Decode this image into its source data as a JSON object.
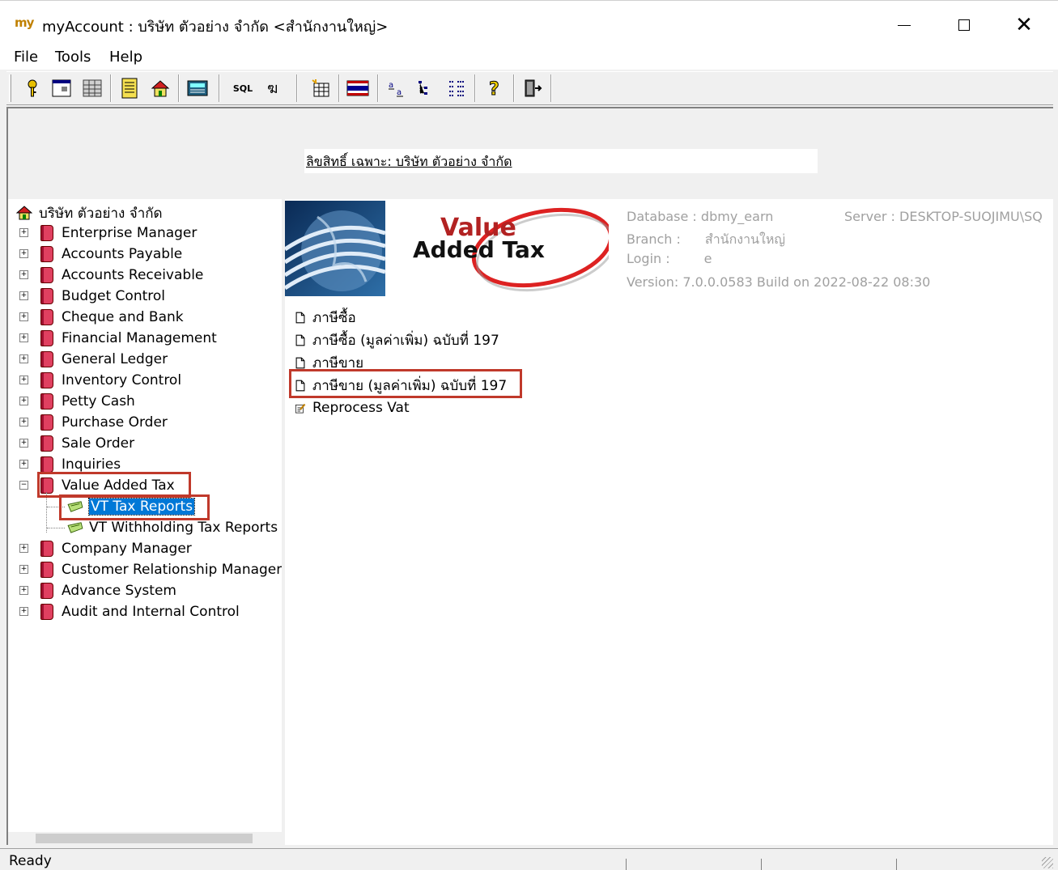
{
  "window": {
    "app_icon_label": "my",
    "title": "myAccount : บริษัท ตัวอย่าง จำกัด <สำนักงานใหญ่>"
  },
  "menu": {
    "items": [
      {
        "label": "File"
      },
      {
        "label": "Tools"
      },
      {
        "label": "Help"
      }
    ]
  },
  "toolbar": {
    "buttons": [
      {
        "icon": "key-icon"
      },
      {
        "icon": "window-icon"
      },
      {
        "icon": "grid-icon"
      },
      {
        "icon": "ledger-icon"
      },
      {
        "icon": "home-icon"
      },
      {
        "icon": "calculator-icon"
      },
      {
        "icon": "sql-icon",
        "label": "SQL"
      },
      {
        "icon": "translate-icon"
      },
      {
        "icon": "table-new-icon"
      },
      {
        "icon": "flag-icon"
      },
      {
        "icon": "text-format-icon"
      },
      {
        "icon": "tree-view-icon"
      },
      {
        "icon": "list-view-icon"
      },
      {
        "icon": "help-icon"
      },
      {
        "icon": "exit-icon"
      }
    ]
  },
  "header": {
    "license_text": "ลิขสิทธิ์ เฉพาะ: บริษัท ตัวอย่าง จำกัด"
  },
  "tree": {
    "root_label": "บริษัท ตัวอย่าง จำกัด",
    "items": [
      {
        "label": "Enterprise Manager"
      },
      {
        "label": "Accounts Payable"
      },
      {
        "label": "Accounts Receivable"
      },
      {
        "label": "Budget Control"
      },
      {
        "label": "Cheque and Bank"
      },
      {
        "label": "Financial Management"
      },
      {
        "label": "General Ledger"
      },
      {
        "label": "Inventory Control"
      },
      {
        "label": "Petty Cash"
      },
      {
        "label": "Purchase Order"
      },
      {
        "label": "Sale Order"
      },
      {
        "label": "Inquiries"
      },
      {
        "label": "Value Added Tax"
      },
      {
        "label": "VT Tax Reports"
      },
      {
        "label": "VT Withholding Tax Reports"
      },
      {
        "label": "Company Manager"
      },
      {
        "label": "Customer Relationship Management"
      },
      {
        "label": "Advance System"
      },
      {
        "label": "Audit and Internal Control"
      }
    ]
  },
  "banner": {
    "word1": "Value",
    "word2": "Added Tax"
  },
  "info": {
    "database_label": "Database :",
    "database_value": "dbmy_earn",
    "server_label": "Server :",
    "server_value": "DESKTOP-SUOJIMU\\SQ",
    "branch_label": "Branch :",
    "branch_value": "สำนักงานใหญ่",
    "login_label": "Login :",
    "login_value": "e",
    "version_text": "Version: 7.0.0.0583  Build on 2022-08-22 08:30"
  },
  "content": {
    "items": [
      {
        "label": "ภาษีซื้อ",
        "icon": "document-icon"
      },
      {
        "label": "ภาษีซื้อ (มูลค่าเพิ่ม) ฉบับที่ 197",
        "icon": "document-icon"
      },
      {
        "label": "ภาษีขาย",
        "icon": "document-icon"
      },
      {
        "label": "ภาษีขาย (มูลค่าเพิ่ม) ฉบับที่ 197",
        "icon": "document-icon"
      },
      {
        "label": "Reprocess Vat",
        "icon": "edit-document-icon"
      }
    ]
  },
  "status": {
    "text": "Ready"
  },
  "colors": {
    "selection": "#0078d7",
    "highlight_outline": "#c0392b",
    "book": "#e04060",
    "banner_red": "#b22222"
  }
}
